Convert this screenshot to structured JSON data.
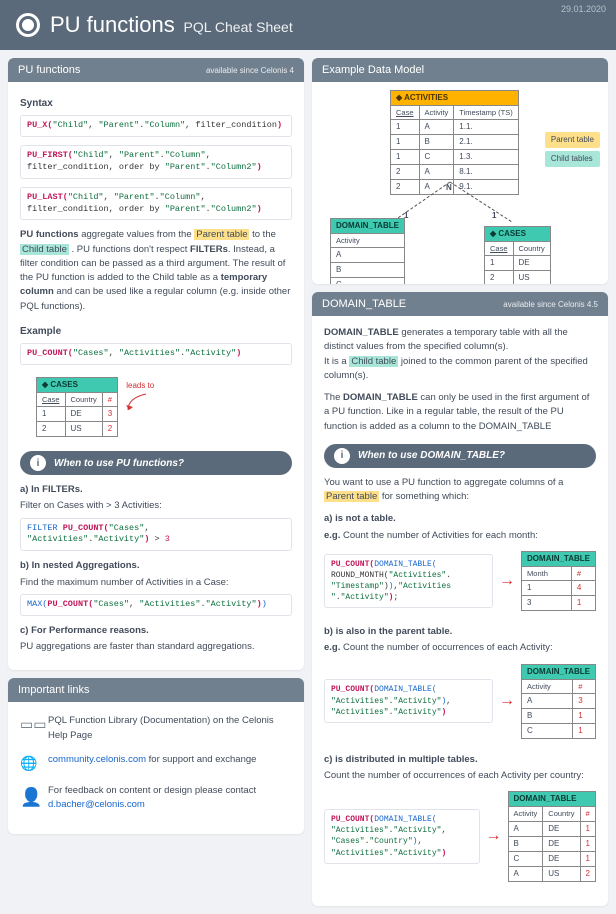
{
  "date": "29.01.2020",
  "title": "PU functions",
  "subtitle": "PQL Cheat Sheet",
  "left": {
    "pu": {
      "header": "PU functions",
      "since": "available since Celonis 4",
      "syntax_label": "Syntax",
      "code1": "PU_X(\"Child\", \"Parent\".\"Column\", filter_condition)",
      "code2": "PU_FIRST(\"Child\", \"Parent\".\"Column\",\nfilter_condition, order by \"Parent\".\"Column2\")",
      "code3": "PU_LAST(\"Child\", \"Parent\".\"Column\",\nfilter_condition, order by \"Parent\".\"Column2\")",
      "desc1a": "PU functions",
      "desc1b": " aggregate values from the ",
      "parent_label": "Parent table",
      "desc1c": " to the ",
      "child_label": "Child table",
      "desc1d": " . PU functions don't respect ",
      "filters_bold": "FILTERs",
      "desc1e": ". Instead, a filter condition can be passed as a third argument. The result of the PU function is added to the Child table as a ",
      "temp_bold": "temporary column",
      "desc1f": " and can be used like a regular column (e.g. inside other PQL functions).",
      "example_label": "Example",
      "example_code": "PU_COUNT(\"Cases\", \"Activities\".\"Activity\")",
      "leads_to": "leads to",
      "cases_table": {
        "title": "CASES",
        "cols": [
          "Case",
          "Country",
          "#"
        ],
        "rows": [
          [
            "1",
            "DE",
            "3"
          ],
          [
            "2",
            "US",
            "2"
          ]
        ]
      },
      "when_header": "When to use PU functions?",
      "a_title": "a) In FILTERs.",
      "a_text": "Filter on Cases with > 3 Activities:",
      "a_code": "FILTER PU_COUNT(\"Cases\",\n\"Activities\".\"Activity\") > 3",
      "b_title": "b) In nested Aggregations.",
      "b_text": "Find the maximum number of Activities in a Case:",
      "b_code": "MAX(PU_COUNT(\"Cases\", \"Activities\".\"Activity\"))",
      "c_title": "c) For Performance reasons.",
      "c_text": "PU aggregations are faster than standard aggregations."
    },
    "links": {
      "header": "Important links",
      "l1": "PQL Function Library (Documentation) on the Celonis Help Page",
      "l2a": "community.celonis.com",
      "l2b": " for support and exchange",
      "l3a": "For feedback on content or design please contact ",
      "l3b": "d.bacher@celonis.com"
    }
  },
  "right": {
    "model": {
      "header": "Example Data Model",
      "activities": {
        "title": "ACTIVITIES",
        "cols": [
          "Case",
          "Activity",
          "Timestamp (TS)"
        ],
        "rows": [
          [
            "1",
            "A",
            "1.1."
          ],
          [
            "1",
            "B",
            "2.1."
          ],
          [
            "1",
            "C",
            "1.3."
          ],
          [
            "2",
            "A",
            "8.1."
          ],
          [
            "2",
            "A",
            "9.1."
          ]
        ]
      },
      "domain": {
        "title": "DOMAIN_TABLE",
        "col": "Activity",
        "rows": [
          "A",
          "B",
          "C"
        ]
      },
      "cases": {
        "title": "CASES",
        "cols": [
          "Case",
          "Country"
        ],
        "rows": [
          [
            "1",
            "DE"
          ],
          [
            "2",
            "US"
          ]
        ]
      },
      "n_label": "N",
      "one_label": "1",
      "legend_parent": "Parent table",
      "legend_child": "Child tables"
    },
    "dt": {
      "header": "DOMAIN_TABLE",
      "since": "available since Celonis 4.5",
      "p1a": "DOMAIN_TABLE",
      "p1b": " generates a temporary table with all the distinct values from the specified column(s).",
      "p2a": "It is a ",
      "child_label": "Child table",
      "p2b": " joined to the common parent of the specified column(s).",
      "p3a": "The ",
      "p3b": "DOMAIN_TABLE",
      "p3c": " can only be used in the first argument of a PU function. Like in a regular table, the result of the PU function is added as a column to the DOMAIN_TABLE",
      "when_header": "When to use DOMAIN_TABLE?",
      "intro1": "You want to use a PU function to aggregate columns of a ",
      "parent_label": "Parent table",
      "intro2": " for something which:",
      "a_title": "a) is not a table.",
      "a_eg": "e.g.",
      "a_text": " Count the number of Activities for each month:",
      "a_code": "PU_COUNT(DOMAIN_TABLE(\nROUND_MONTH(\"Activities\".\n\"Timestamp\")),\"Activities\n\".\"Activity\");",
      "a_table": {
        "title": "DOMAIN_TABLE",
        "cols": [
          "Month",
          "#"
        ],
        "rows": [
          [
            "1",
            "4"
          ],
          [
            "3",
            "1"
          ]
        ]
      },
      "b_title": "b) is also in the parent table.",
      "b_text": " Count the number of occurrences of each Activity:",
      "b_code": "PU_COUNT(DOMAIN_TABLE(\n\"Activities\".\"Activity\"),\n\"Activities\".\"Activity\")",
      "b_table": {
        "title": "DOMAIN_TABLE",
        "cols": [
          "Activity",
          "#"
        ],
        "rows": [
          [
            "A",
            "3"
          ],
          [
            "B",
            "1"
          ],
          [
            "C",
            "1"
          ]
        ]
      },
      "c_title": "c) is distributed in multiple tables.",
      "c_text": "Count the number of occurrences of each Activity per country:",
      "c_code": "PU_COUNT(DOMAIN_TABLE(\n\"Activities\".\"Activity\",\n\"Cases\".\"Country\"),\n\"Activities\".\"Activity\")",
      "c_table": {
        "title": "DOMAIN_TABLE",
        "cols": [
          "Activity",
          "Country",
          "#"
        ],
        "rows": [
          [
            "A",
            "DE",
            "1"
          ],
          [
            "B",
            "DE",
            "1"
          ],
          [
            "C",
            "DE",
            "1"
          ],
          [
            "A",
            "US",
            "2"
          ]
        ]
      }
    }
  }
}
